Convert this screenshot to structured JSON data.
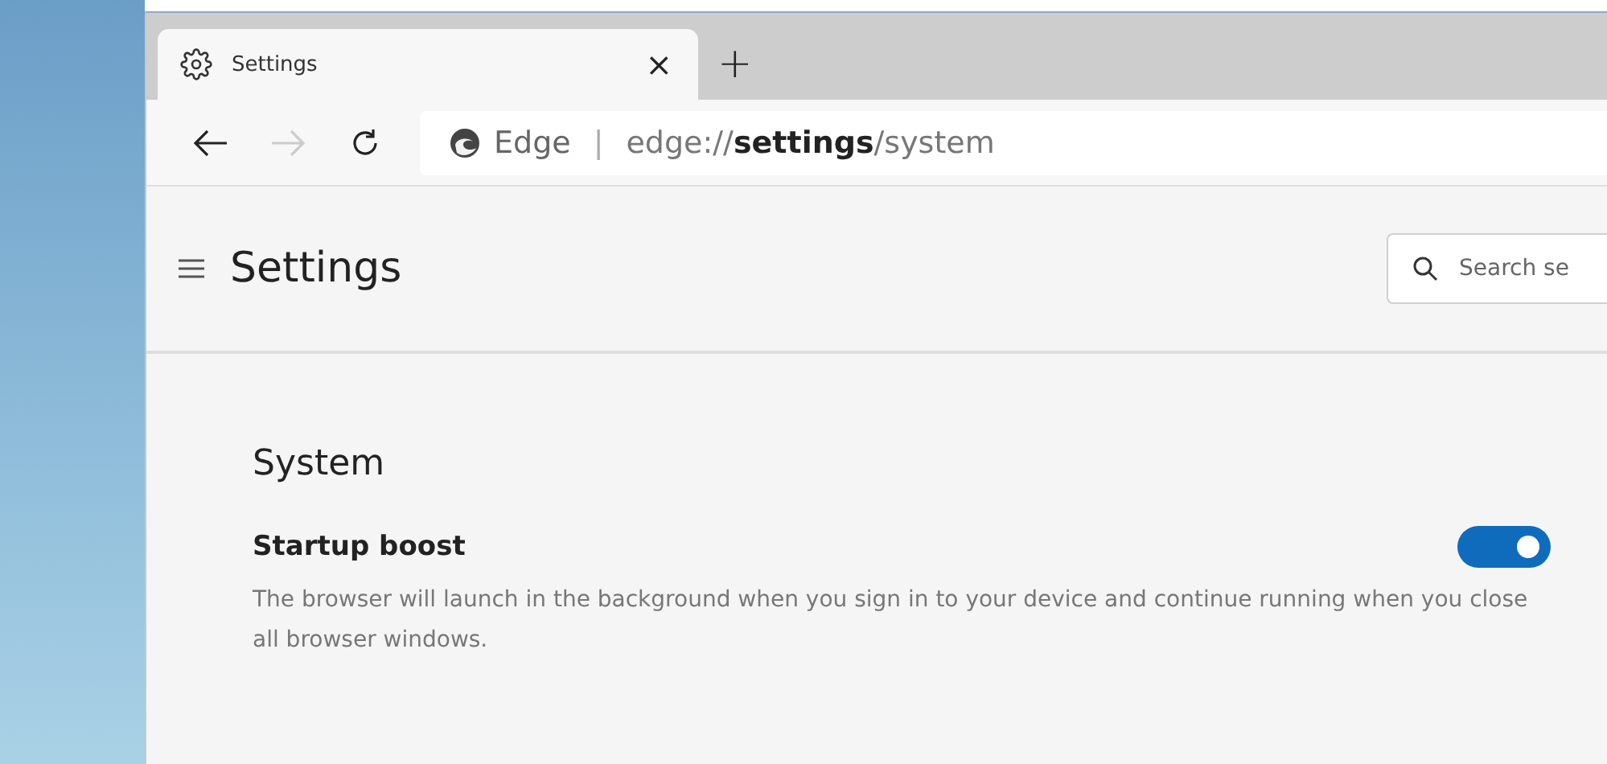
{
  "tabs": [
    {
      "label": "Settings",
      "selected": true,
      "close": "×"
    }
  ],
  "new_tab": "+",
  "toolbar": {
    "back_disabled": false,
    "forward_disabled": true
  },
  "address_bar": {
    "site": "Edge",
    "separator": "|",
    "url": "edge://**settings**/system"
  },
  "header": {
    "title": "Settings",
    "search": {
      "placeholder": "Search se"
    }
  },
  "section": {
    "title": "System",
    "settings": [
      {
        "kind": "toggle",
        "label": "Startup boost",
        "on": true,
        "description": "The browser will launch in the background when you sign in to your device and continue running when you close all browser windows."
      }
    ]
  }
}
